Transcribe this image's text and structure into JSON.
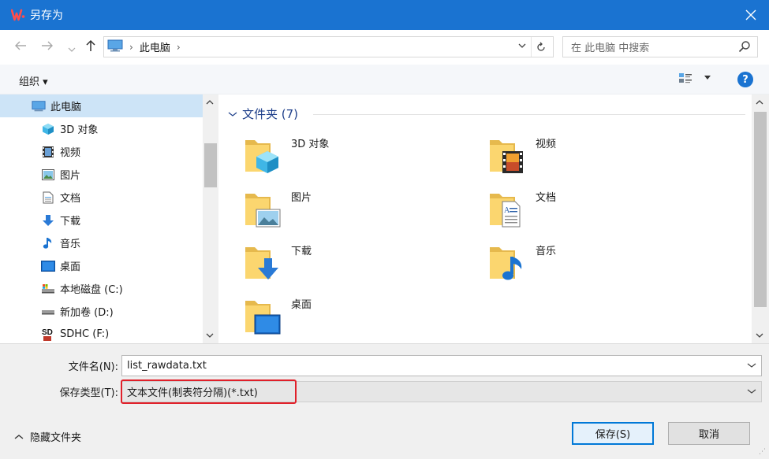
{
  "window": {
    "title": "另存为",
    "accent": "#1a73d1"
  },
  "nav": {
    "breadcrumb": "此电脑",
    "search_placeholder": "在 此电脑 中搜索"
  },
  "toolbar": {
    "organize_label": "组织 ▾"
  },
  "sidebar": {
    "items": [
      {
        "label": "此电脑",
        "icon": "computer-icon",
        "selected": true
      },
      {
        "label": "3D 对象",
        "icon": "cube-icon"
      },
      {
        "label": "视频",
        "icon": "video-icon"
      },
      {
        "label": "图片",
        "icon": "picture-icon"
      },
      {
        "label": "文档",
        "icon": "document-icon"
      },
      {
        "label": "下载",
        "icon": "download-icon"
      },
      {
        "label": "音乐",
        "icon": "music-icon"
      },
      {
        "label": "桌面",
        "icon": "desktop-icon"
      },
      {
        "label": "本地磁盘 (C:)",
        "icon": "drive-icon"
      },
      {
        "label": "新加卷 (D:)",
        "icon": "drive-icon"
      },
      {
        "label": "SDHC (F:)",
        "icon": "sd-card-icon"
      }
    ]
  },
  "content": {
    "group_header": "文件夹 (7)",
    "folders": [
      {
        "label": "3D 对象",
        "icon": "cube-folder-icon"
      },
      {
        "label": "视频",
        "icon": "video-folder-icon"
      },
      {
        "label": "图片",
        "icon": "picture-folder-icon"
      },
      {
        "label": "文档",
        "icon": "document-folder-icon"
      },
      {
        "label": "下载",
        "icon": "download-folder-icon"
      },
      {
        "label": "音乐",
        "icon": "music-folder-icon"
      },
      {
        "label": "桌面",
        "icon": "desktop-folder-icon"
      }
    ]
  },
  "form": {
    "filename_label": "文件名(N):",
    "filename_value": "list_rawdata.txt",
    "filetype_label": "保存类型(T):",
    "filetype_value": "文本文件(制表符分隔)(*.txt)",
    "highlight_color": "#e0202a"
  },
  "footer": {
    "hide_folders_label": "隐藏文件夹",
    "save_label": "保存(S)",
    "cancel_label": "取消"
  }
}
